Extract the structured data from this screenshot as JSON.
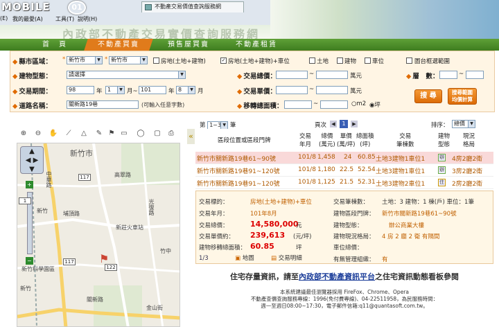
{
  "browser": {
    "logo_text": "MOBILE",
    "logo_badge": "01",
    "menu": [
      "(E)",
      "我的最愛(A)",
      "工具(T)",
      "說明(H)"
    ],
    "tabs": [
      {
        "label": "不動產交易價值查詢服務網",
        "active": true
      }
    ],
    "window_buttons": [
      "–",
      "□",
      "×"
    ]
  },
  "site": {
    "banner_title": "內政部不動產交易實價查詢服務網",
    "nav": [
      "首　頁",
      "不動產買賣",
      "預售屋買賣",
      "不動產租賃"
    ],
    "nav_active": 1,
    "accent": "#e07b1b",
    "nav_green": "#4e8f2a"
  },
  "form": {
    "labels": {
      "region": "縣市區域：",
      "building_type": "建物型態：",
      "period": "交易期間：",
      "road": "道路名稱：",
      "total_price": "交易總價：",
      "unit_price": "交易單價：",
      "area": "移轉總面積：",
      "floor": "層　數："
    },
    "county": "新竹市",
    "district": "新竹市",
    "options": [
      "房地(土地+建物)",
      "房地(土地+建物)+車位",
      "土地",
      "建物",
      "車位"
    ],
    "options_checked": [
      false,
      true,
      false,
      false,
      false
    ],
    "map_select_label": "圖台框選範圍",
    "building_type_value": "請選擇",
    "period_from_year": "98",
    "period_from_month": "1",
    "period_sep": "月~",
    "period_to_year": "101",
    "period_to_month": "8",
    "year_suffix": "年",
    "month_suffix": "月",
    "road_value": "關新路19巷",
    "road_hint": "(可輸入任意字數)",
    "unit_wan": "萬元",
    "unit_sep": "~",
    "area_units": [
      "m2",
      "坪"
    ],
    "search_button": "搜 尋",
    "calc_button_l1": "搜尋範圍",
    "calc_button_l2": "均價計算"
  },
  "map": {
    "labels": [
      "新竹市",
      "中華路",
      "高翠路",
      "新竹",
      "埔頂路",
      "光復路",
      "新莊火車站",
      "竹中",
      "新竹科學園區",
      "新竹",
      "金山街",
      "關新路"
    ],
    "shields": [
      "117",
      "117",
      "1",
      "122"
    ],
    "zoom_plus": "+",
    "zoom_minus": "−"
  },
  "results": {
    "page_label": "第 1~3 筆",
    "page_select": "1~3",
    "pages_label": "頁次",
    "page_num": "1",
    "sort_label": "排序：",
    "sort_value": "總價",
    "headers": {
      "address": "區段位置或區段門牌",
      "date1": "交易",
      "date2": "年月",
      "total1": "總價",
      "total2": "(萬元)",
      "unit1": "單價",
      "unit2": "(萬/坪)",
      "area1": "總面積",
      "area2": "(坪)",
      "item1": "交易",
      "item2": "筆棟數",
      "type1": "建物",
      "type2": "型態",
      "layout1": "現況",
      "layout2": "格局"
    },
    "rows": [
      {
        "address": "新竹市關新路19巷61~90號",
        "date": "101/8",
        "total": "1,458",
        "unit": "24",
        "area": "60.85",
        "items": "土地3建物1車位1",
        "type_icon": "辦",
        "layout": "4房2廳2衛",
        "highlight": true
      },
      {
        "address": "新竹市關新路19巷91~120號",
        "date": "101/8",
        "total": "1,180",
        "unit": "22.5",
        "area": "52.54",
        "items": "土地3建物1車位1",
        "type_icon": "辦",
        "layout": "3房2廳2衛",
        "highlight": false
      },
      {
        "address": "新竹市關新路19巷91~120號",
        "date": "101/8",
        "total": "1,125",
        "unit": "21.5",
        "area": "52.31",
        "items": "土地3建物2車位1",
        "type_icon": "住",
        "layout": "2房2廳2衛",
        "highlight": false
      }
    ],
    "row_colors": {
      "highlight_bg": "#f9d9d9",
      "text": "#b05a00"
    }
  },
  "detail": {
    "left": [
      {
        "k": "交易標的：",
        "v": "房地(土地+建物)+車位"
      },
      {
        "k": "交易年月：",
        "v": "101年8月"
      },
      {
        "k": "交易總價：",
        "v": "14,580,000",
        "unit": "元"
      },
      {
        "k": "交易單價約：",
        "v": "239,613",
        "unit": "(元/坪)"
      },
      {
        "k": "建物移轉總面積：",
        "v": "60.85",
        "unit": "坪"
      }
    ],
    "right": [
      {
        "k": "交易筆棟數：",
        "v": "土地：3 建物：1 棟(戶) 車位：1筆"
      },
      {
        "k": "建物區段門牌：",
        "v": "新竹市關新路19巷61~90號"
      },
      {
        "k": "建物型態：",
        "v": "辦公商業大樓"
      },
      {
        "k": "建物現況格局：",
        "v": "4 房 2 廳 2 衛 有隔間"
      },
      {
        "k": "車位總價：",
        "v": ""
      },
      {
        "k": "有無管理組織：",
        "v": "有"
      }
    ],
    "pagination": "1/3",
    "map_link": "地圖",
    "detail_link": "交易明細"
  },
  "promo": {
    "before": "住宅存量資訊，請至",
    "link": "內政部不動產資訊平台",
    "after": "之住宅資訊動態看板參閱"
  },
  "footer": [
    "本系統建議最佳瀏覽器採用 FireFox、Chrome、Opera",
    "不動產查價查詢服務專線：1996(免付費專線)、04-22511958，為民服務時間：",
    "週一至週日08:00~17:30，電子郵件信箱:q11@quantasoft.com.tw。"
  ]
}
